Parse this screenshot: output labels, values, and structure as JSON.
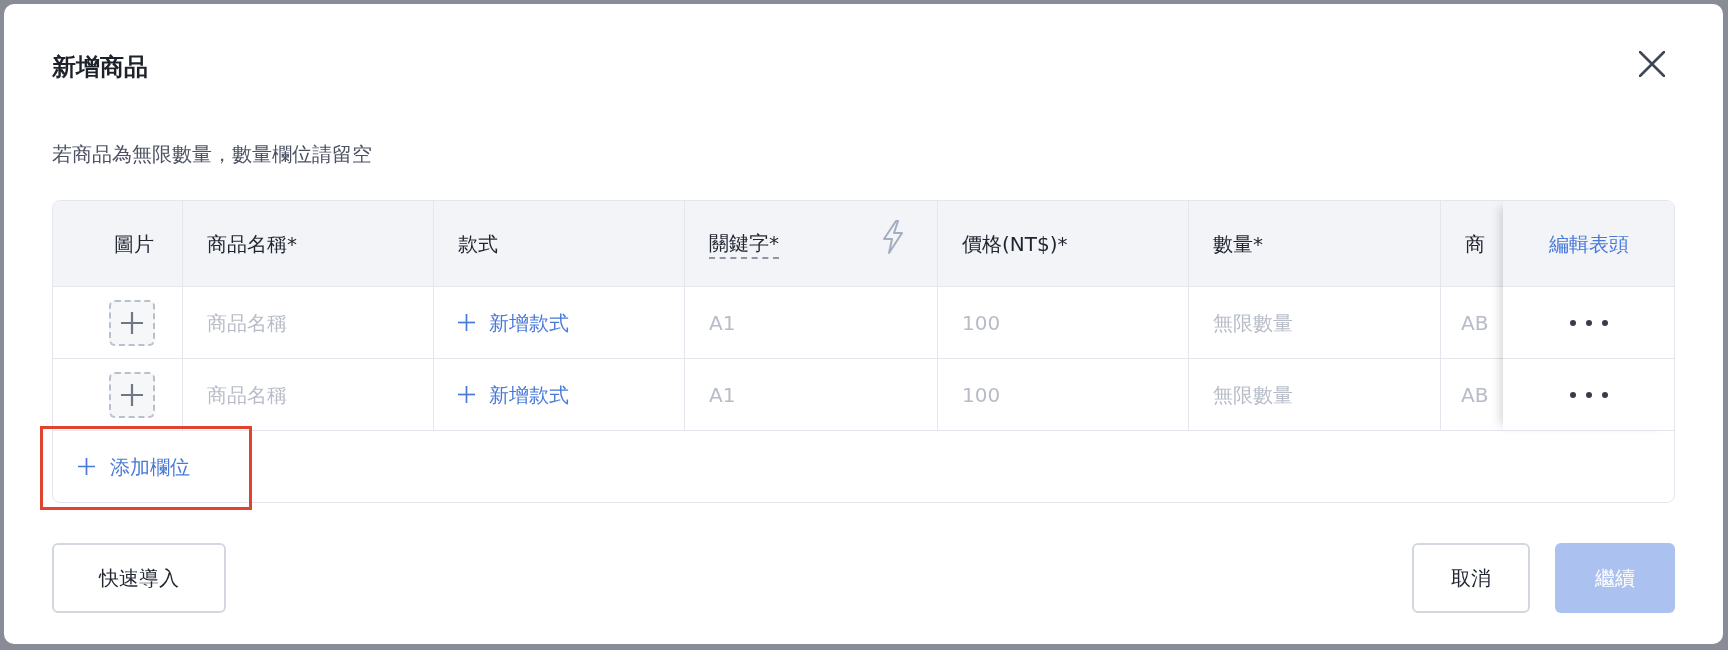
{
  "dialog": {
    "title": "新增商品",
    "note": "若商品為無限數量，數量欄位請留空"
  },
  "table": {
    "columns": [
      {
        "label": "圖片",
        "kind": "plain"
      },
      {
        "label": "商品名稱*",
        "kind": "plain"
      },
      {
        "label": "款式",
        "kind": "plain"
      },
      {
        "label": "關鍵字*",
        "kind": "keyword"
      },
      {
        "label": "價格(NT$)*",
        "kind": "plain"
      },
      {
        "label": "數量*",
        "kind": "plain"
      },
      {
        "label": "商",
        "kind": "plain"
      }
    ],
    "header_action": "編輯表頭",
    "rows": [
      {
        "name_placeholder": "商品名稱",
        "variant_button": "新增款式",
        "keyword_placeholder": "A1",
        "price_placeholder": "100",
        "quantity_placeholder": "無限數量",
        "column_7_placeholder": "AB"
      },
      {
        "name_placeholder": "商品名稱",
        "variant_button": "新增款式",
        "keyword_placeholder": "A1",
        "price_placeholder": "100",
        "quantity_placeholder": "無限數量",
        "column_7_placeholder": "AB"
      }
    ]
  },
  "add_column": {
    "label": "添加欄位",
    "highlighted": true
  },
  "footer": {
    "import_button": "快速導入",
    "cancel_button": "取消",
    "continue_button": {
      "label": "繼續",
      "disabled": true
    }
  }
}
